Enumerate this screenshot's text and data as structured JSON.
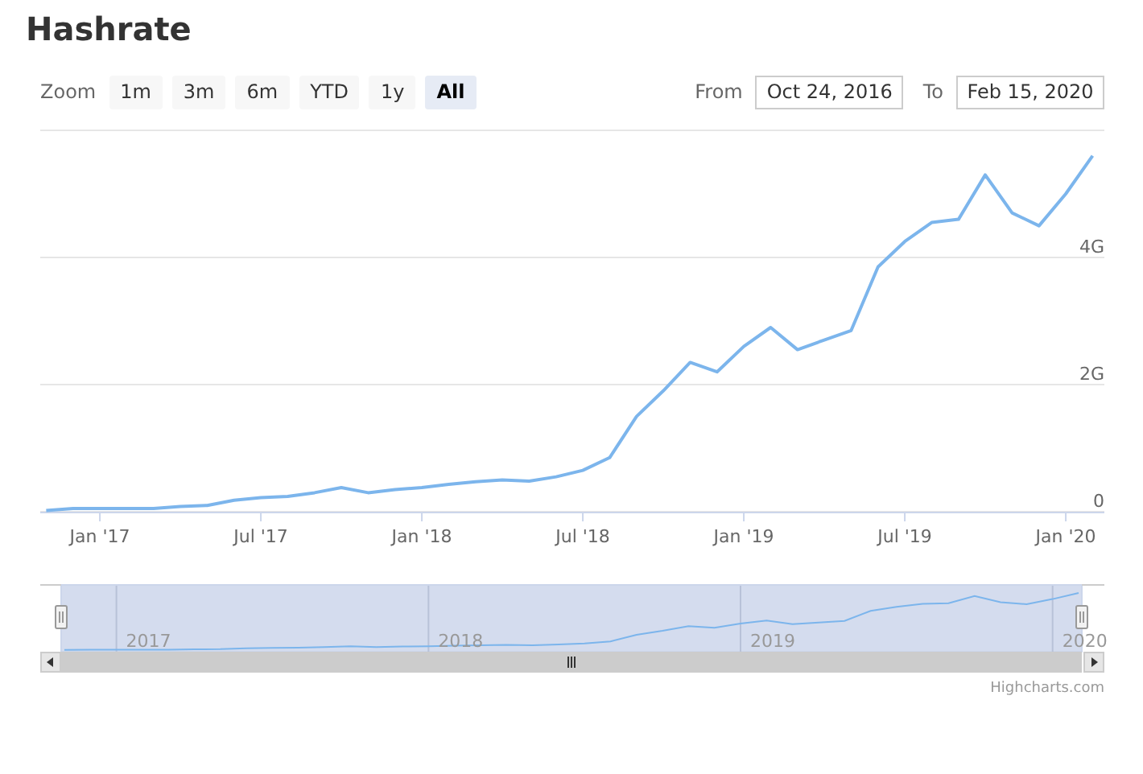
{
  "title": "Hashrate",
  "range_selector": {
    "label": "Zoom",
    "buttons": [
      {
        "label": "1m",
        "selected": false
      },
      {
        "label": "3m",
        "selected": false
      },
      {
        "label": "6m",
        "selected": false
      },
      {
        "label": "YTD",
        "selected": false
      },
      {
        "label": "1y",
        "selected": false
      },
      {
        "label": "All",
        "selected": true
      }
    ],
    "from_label": "From",
    "from_value": "Oct 24, 2016",
    "to_label": "To",
    "to_value": "Feb 15, 2020"
  },
  "chart": {
    "chart_data": {
      "type": "line",
      "ylim": [
        0,
        6
      ],
      "categories": [
        null,
        null,
        "Jan '17",
        null,
        null,
        null,
        null,
        null,
        "Jul '17",
        null,
        null,
        null,
        null,
        null,
        "Jan '18",
        null,
        null,
        null,
        null,
        null,
        "Jul '18",
        null,
        null,
        null,
        null,
        null,
        "Jan '19",
        null,
        null,
        null,
        null,
        null,
        "Jul '19",
        null,
        null,
        null,
        null,
        null,
        "Jan '20",
        null
      ],
      "yticks": [
        {
          "value": 0,
          "label": "0"
        },
        {
          "value": 2,
          "label": "2G"
        },
        {
          "value": 4,
          "label": "4G"
        }
      ],
      "series": [
        {
          "color": "#7cb5ec",
          "values": [
            0.02,
            0.05,
            0.05,
            0.05,
            0.05,
            0.08,
            0.1,
            0.18,
            0.22,
            0.24,
            0.3,
            0.38,
            0.3,
            0.35,
            0.38,
            0.43,
            0.47,
            0.5,
            0.48,
            0.55,
            0.65,
            0.85,
            1.5,
            1.9,
            2.35,
            2.2,
            2.6,
            2.9,
            2.55,
            2.7,
            2.85,
            3.85,
            4.25,
            4.55,
            4.6,
            5.3,
            4.7,
            4.5,
            5.0,
            5.6
          ]
        }
      ]
    }
  },
  "navigator": {
    "labels": [
      "2017",
      "2018",
      "2019",
      "2020"
    ]
  },
  "credits": "Highcharts.com"
}
